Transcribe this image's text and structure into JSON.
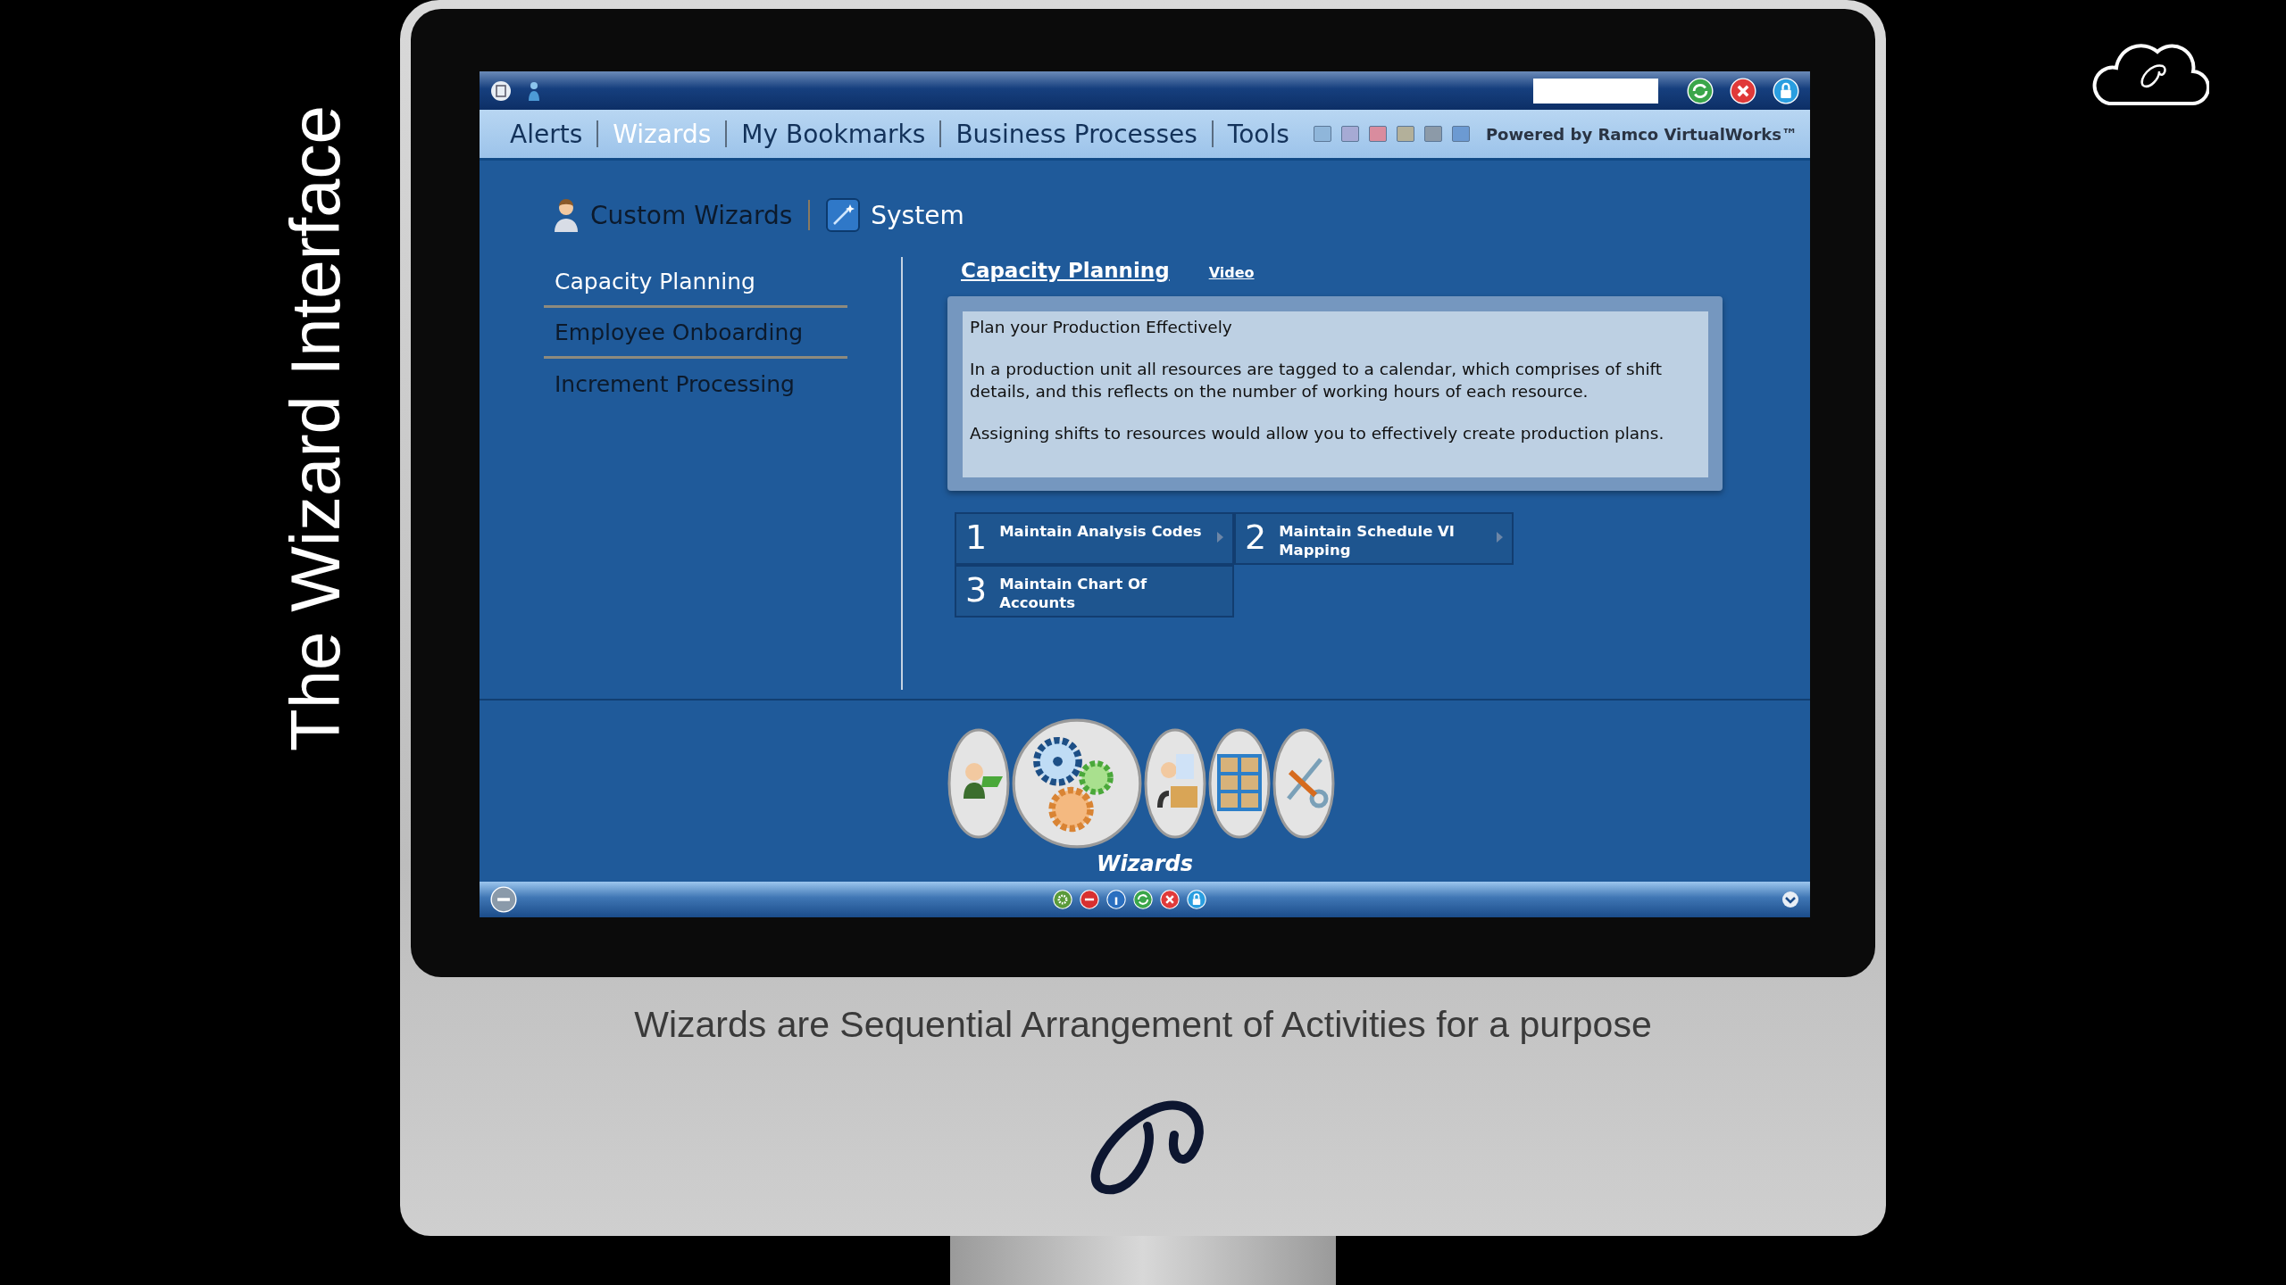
{
  "slide_title": "The Wizard Interface",
  "nav": {
    "tabs": [
      {
        "label": "Alerts",
        "selected": false
      },
      {
        "label": "Wizards",
        "selected": true
      },
      {
        "label": "My Bookmarks",
        "selected": false
      },
      {
        "label": "Business Processes",
        "selected": false
      },
      {
        "label": "Tools",
        "selected": false
      }
    ],
    "themes": [
      {
        "color": "#8fb6da"
      },
      {
        "color": "#a6aad4"
      },
      {
        "color": "#d98c9e"
      },
      {
        "color": "#b3b09a"
      },
      {
        "color": "#8c9aa8"
      },
      {
        "color": "#6c9ad2"
      }
    ],
    "powered_by": "Powered by Ramco VirtualWorks™"
  },
  "wizard_groups": [
    {
      "label": "Custom Wizards",
      "kind": "person",
      "selected": false
    },
    {
      "label": "System",
      "kind": "wand",
      "selected": true
    }
  ],
  "wizards": [
    {
      "label": "Capacity Planning",
      "selected": true
    },
    {
      "label": "Employee Onboarding",
      "selected": false
    },
    {
      "label": "Increment Processing",
      "selected": false
    }
  ],
  "detail": {
    "title": "Capacity Planning",
    "video_link": "Video",
    "paragraphs": [
      "Plan your Production Effectively",
      "In a production unit all resources are tagged to a calendar, which comprises of shift details, and this reflects on the number of working hours of each resource.",
      "Assigning shifts to resources would allow you to effectively create production plans."
    ]
  },
  "steps": [
    {
      "number": "1",
      "label": "Maintain Analysis Codes",
      "arrow": true
    },
    {
      "number": "2",
      "label": "Maintain Schedule VI Mapping",
      "arrow": true
    },
    {
      "number": "3",
      "label": "Maintain Chart Of Accounts",
      "arrow": false
    }
  ],
  "dock": {
    "items": [
      {
        "kind": "person",
        "selected": false
      },
      {
        "kind": "gears",
        "selected": true
      },
      {
        "kind": "box",
        "selected": false
      },
      {
        "kind": "shelves",
        "selected": false
      },
      {
        "kind": "tools",
        "selected": false
      }
    ],
    "label": "Wizards"
  },
  "caption": "Wizards are Sequential Arrangement of Activities for a purpose"
}
